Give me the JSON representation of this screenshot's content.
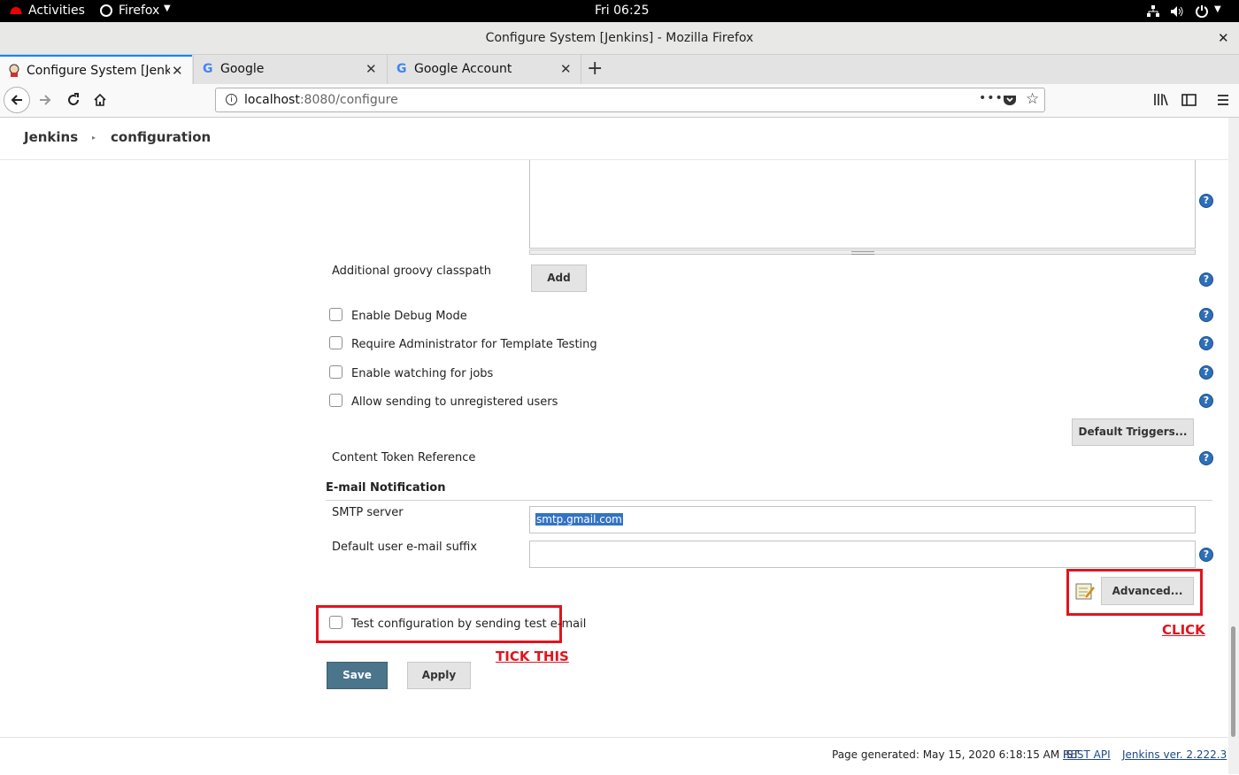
{
  "system_bar": {
    "activities": "Activities",
    "app_menu": "Firefox",
    "clock": "Fri 06:25"
  },
  "window": {
    "title": "Configure System [Jenkins] - Mozilla Firefox",
    "close": "✕"
  },
  "tabs": [
    {
      "label": "Configure System [Jenkins]",
      "active": true
    },
    {
      "label": "Google",
      "active": false
    },
    {
      "label": "Google Account",
      "active": false
    }
  ],
  "new_tab": "+",
  "url": {
    "host": "localhost",
    "path": ":8080/configure"
  },
  "breadcrumb": {
    "root": "Jenkins",
    "page": "configuration"
  },
  "form": {
    "groovy_classpath_label": "Additional groovy classpath",
    "add_button": "Add",
    "checkboxes": [
      {
        "label": "Enable Debug Mode",
        "checked": false
      },
      {
        "label": "Require Administrator for Template Testing",
        "checked": false
      },
      {
        "label": "Enable watching for jobs",
        "checked": false
      },
      {
        "label": "Allow sending to unregistered users",
        "checked": false
      }
    ],
    "default_triggers_button": "Default Triggers...",
    "content_token_label": "Content Token Reference",
    "email_section_title": "E-mail Notification",
    "smtp_label": "SMTP server",
    "smtp_value": "smtp.gmail.com",
    "suffix_label": "Default user e-mail suffix",
    "suffix_value": "",
    "advanced_button": "Advanced...",
    "test_config_label": "Test configuration by sending test e-mail",
    "test_config_checked": false,
    "save_button": "Save",
    "apply_button": "Apply",
    "help_glyph": "?"
  },
  "annotations": {
    "click": "CLICK",
    "tick_this": "TICK THIS",
    "color": "#e1141e"
  },
  "footer": {
    "generated": "Page generated: May 15, 2020 6:18:15 AM IST",
    "rest_api": "REST API",
    "version": "Jenkins ver. 2.222.3"
  },
  "colors": {
    "save_button": "#4b758b",
    "help_icon": "#2d6fb8",
    "selection": "#3373c5"
  }
}
